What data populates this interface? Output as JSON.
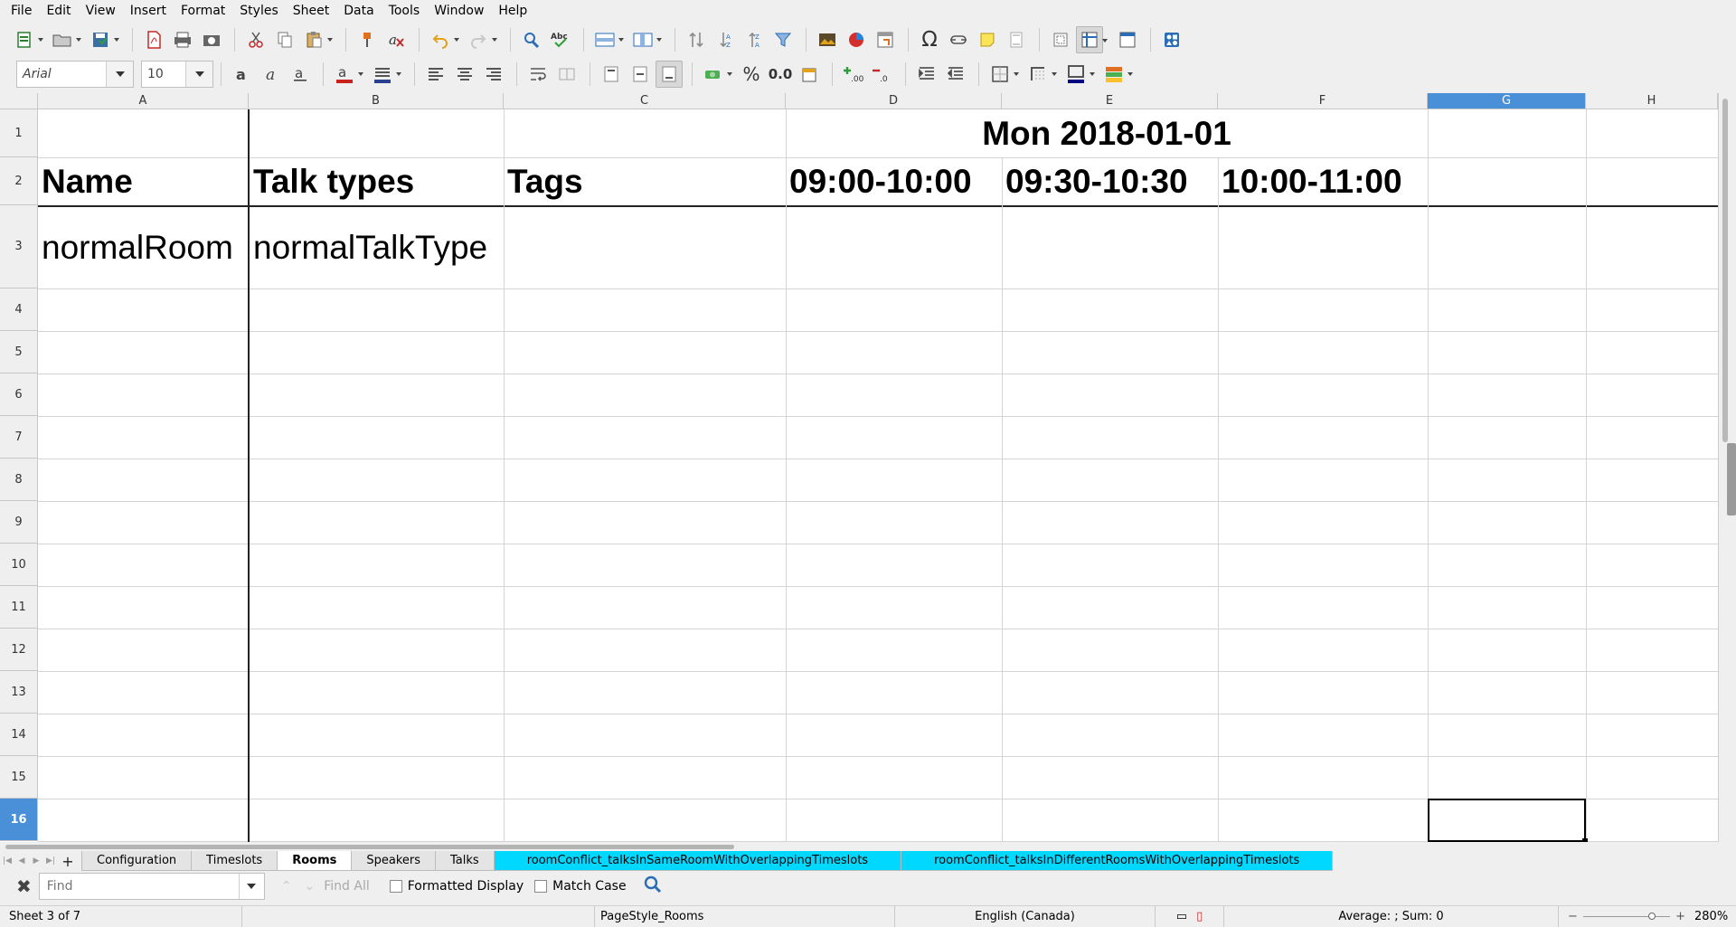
{
  "menu": [
    "File",
    "Edit",
    "View",
    "Insert",
    "Format",
    "Styles",
    "Sheet",
    "Data",
    "Tools",
    "Window",
    "Help"
  ],
  "toolbar": {
    "font_name": "Arial",
    "font_size": "10",
    "percent_label": "%",
    "decimal_label": "0.0"
  },
  "columns": [
    "A",
    "B",
    "C",
    "D",
    "E",
    "F",
    "G",
    "H"
  ],
  "selected_column": "G",
  "rows": [
    "1",
    "2",
    "3",
    "4",
    "5",
    "6",
    "7",
    "8",
    "9",
    "10",
    "11",
    "12",
    "13",
    "14",
    "15",
    "16"
  ],
  "selected_row": "16",
  "sheet": {
    "date_header": "Mon 2018-01-01",
    "headers": {
      "name": "Name",
      "talk_types": "Talk types",
      "tags": "Tags",
      "slot1": "09:00-10:00",
      "slot2": "09:30-10:30",
      "slot3": "10:00-11:00"
    },
    "row3": {
      "name": "normalRoom",
      "talk_types": "normalTalkType"
    }
  },
  "tabs": [
    {
      "label": "Configuration",
      "active": false
    },
    {
      "label": "Timeslots",
      "active": false
    },
    {
      "label": "Rooms",
      "active": true
    },
    {
      "label": "Speakers",
      "active": false
    },
    {
      "label": "Talks",
      "active": false
    },
    {
      "label": "roomConflict_talksInSameRoomWithOverlappingTimeslots",
      "highlight": true
    },
    {
      "label": "roomConflict_talksInDifferentRoomsWithOverlappingTimeslots",
      "highlight": true
    }
  ],
  "findbar": {
    "placeholder": "Find",
    "find_all": "Find All",
    "formatted_display": "Formatted Display",
    "match_case": "Match Case"
  },
  "status": {
    "sheet": "Sheet 3 of 7",
    "page_style": "PageStyle_Rooms",
    "language": "English (Canada)",
    "summary": "Average: ; Sum: 0",
    "zoom": "280%"
  },
  "colors": {
    "selection": "#4a90d9",
    "highlight_tab": "#00d8ff"
  }
}
